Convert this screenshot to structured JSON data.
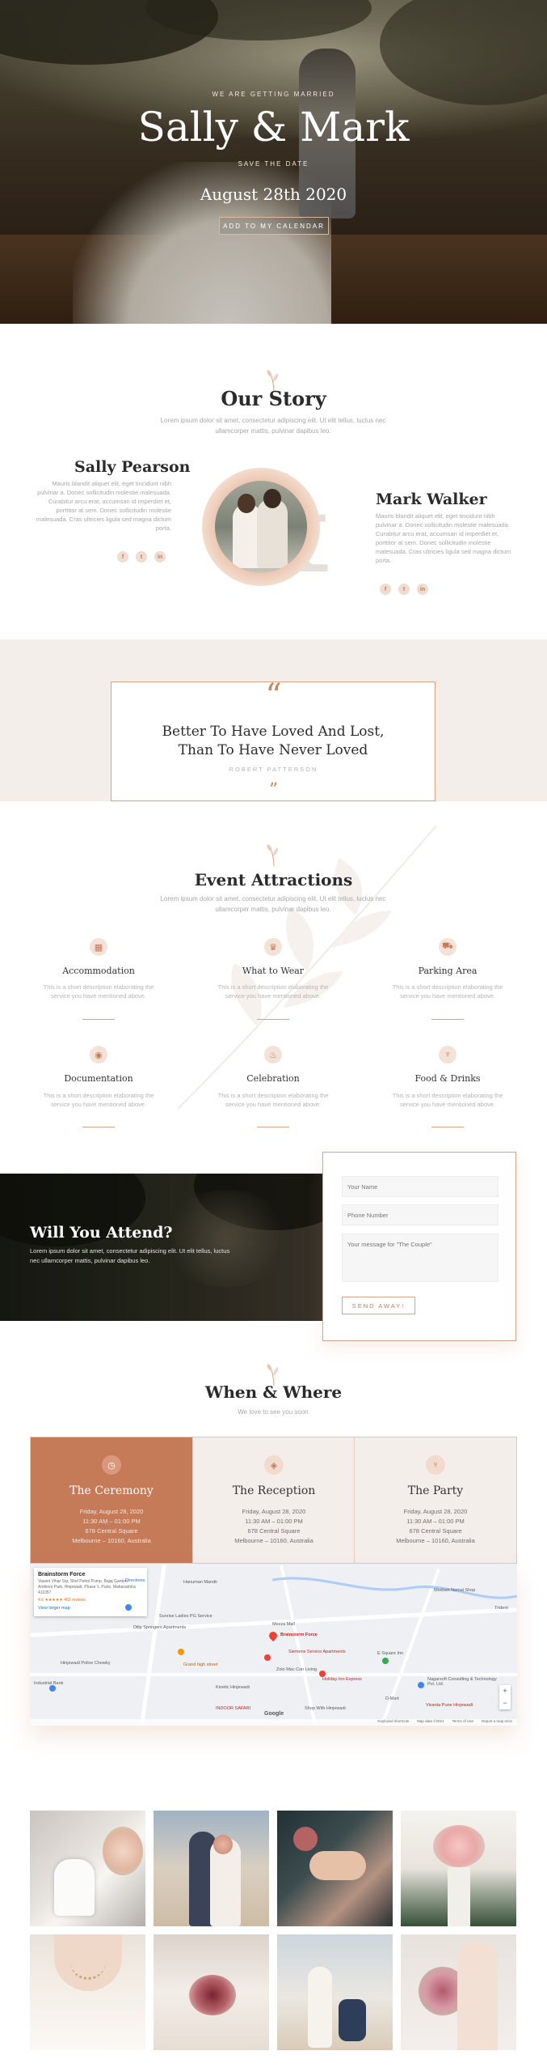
{
  "hero": {
    "eyebrow": "WE ARE GETTING MARRIED",
    "title": "Sally & Mark",
    "subtitle": "SAVE THE DATE",
    "date": "August 28th 2020",
    "button": "ADD TO MY CALENDAR"
  },
  "story": {
    "title": "Our Story",
    "text": "Lorem ipsum dolor sit amet, consectetur adipiscing elit. Ut elit tellus, luctus nec ullamcorper mattis, pulvinar dapibus leo.",
    "bride": {
      "name": "Sally Pearson",
      "text": "Mauris blandit aliquet elit, eget tincidunt nibh pulvinar a. Donec sollicitudin molestie malesuada. Curabitur arcu erat, accumsan id imperdiet et, porttitor at sem. Donec sollicitudin molestie malesuada. Cras ultricies ligula sed magna dictum porta.",
      "social": [
        "f",
        "t",
        "in"
      ]
    },
    "groom": {
      "name": "Mark Walker",
      "text": "Mauris blandit aliquet elit, eget tincidunt nibh pulvinar a. Donec sollicitudin molestie malesuada. Curabitur arcu erat, accumsan id imperdiet et, porttitor at sem. Donec sollicitudin molestie malesuada. Cras ultricies ligula sed magna dictum porta.",
      "social": [
        "f",
        "t",
        "in"
      ]
    },
    "ampersand": "&"
  },
  "quote": {
    "open_mark": "“",
    "line1": "Better To Have Loved And Lost,",
    "line2": "Than To Have Never Loved",
    "author": "ROBERT PATTERSON",
    "close_mark": "”"
  },
  "attractions": {
    "title": "Event Attractions",
    "text": "Lorem ipsum dolor sit amet, consectetur adipiscing elit. Ut elit tellus, luctus nec ullamcorper mattis, pulvinar dapibus leo.",
    "items": [
      {
        "icon": "hotel-icon",
        "glyph": "▦",
        "title": "Accommodation",
        "desc1": "This is a short description elaborating the",
        "desc2": "service you have mentioned above."
      },
      {
        "icon": "crown-icon",
        "glyph": "♛",
        "title": "What to Wear",
        "desc1": "This is a short description elaborating the",
        "desc2": "service you have mentioned above."
      },
      {
        "icon": "car-icon",
        "glyph": "⛟",
        "title": "Parking Area",
        "desc1": "This is a short description elaborating the",
        "desc2": "service you have mentioned above."
      },
      {
        "icon": "camera-icon",
        "glyph": "◉",
        "title": "Documentation",
        "desc1": "This is a short description elaborating the",
        "desc2": "service you have mentioned above."
      },
      {
        "icon": "cake-icon",
        "glyph": "♨",
        "title": "Celebration",
        "desc1": "This is a short description elaborating the",
        "desc2": "service you have mentioned above."
      },
      {
        "icon": "cocktail-icon",
        "glyph": "♆",
        "title": "Food & Drinks",
        "desc1": "This is a short description elaborating the",
        "desc2": "service you have mentioned above."
      }
    ]
  },
  "rsvp": {
    "title": "Will You Attend?",
    "text": "Lorem ipsum dolor sit amet, consectetur adipiscing elit. Ut elit tellus, luctus nec ullamcorper mattis, pulvinar dapibus leo.",
    "name_placeholder": "Your Name",
    "phone_placeholder": "Phone Number",
    "message_placeholder": "Your message for \"The Couple\"",
    "button": "SEND AWAY!"
  },
  "when": {
    "title": "When & Where",
    "subtitle": "We love to see you soon",
    "events": [
      {
        "icon": "clock-icon",
        "glyph": "◷",
        "title": "The Ceremony",
        "date": "Friday, August 28, 2020",
        "time": "11:30 AM – 01:00 PM",
        "street": "678 Central Square",
        "city": "Melbourne – 10160, Australia"
      },
      {
        "icon": "ring-icon",
        "glyph": "◈",
        "title": "The Reception",
        "date": "Friday, August 28, 2020",
        "time": "11:30 AM – 01:00 PM",
        "street": "678 Central Square",
        "city": "Melbourne – 10160, Australia"
      },
      {
        "icon": "cocktail-icon",
        "glyph": "♆",
        "title": "The Party",
        "date": "Friday, August 28, 2020",
        "time": "11:30 AM – 01:00 PM",
        "street": "678 Central Square",
        "city": "Melbourne – 10160, Australia"
      }
    ]
  },
  "map": {
    "card_title": "Brainstorm Force",
    "card_address": "Vasant Vihar Sqr, Shel Petrol Pump, Bajaj Garden Ambient Park, Hinjewadi, Phase 1, Pune, Maharashtra 411057",
    "card_rating": "4.6 ★★★★★  402 reviews",
    "card_link": "View larger map",
    "directions": "Directions",
    "pin_label": "Brainstorm Force",
    "labels": [
      "Hanuman Mandir",
      "Sunrise Ladies PG Service",
      "Dilip Springers Apartments",
      "Hinjewadi Police Chowky",
      "Grand high street",
      "Mezza Mall",
      "Zolo Mac Con Living",
      "Holiday Inn Express",
      "Siemens Service Apartments",
      "E Square Inn",
      "Nagarsoft Consulting & Technology Pvt. Ltd.",
      "Medosh Nemai Shop",
      "Trident",
      "INDOOR SAFARI",
      "Kinetic Hinjewadi",
      "Shop With Hinjewadi",
      "Industrial Bank",
      "D-Mart",
      "Vivanta Pune Hinjewadi"
    ],
    "zoom_in": "+",
    "zoom_out": "−",
    "footer": [
      "Keyboard shortcuts",
      "Map data ©2021",
      "Terms of Use",
      "Report a map error"
    ],
    "brand": "Google"
  },
  "gallery": {
    "items": [
      "wedding-shoes-photo",
      "couple-beach-photo",
      "holding-hands-photo",
      "bouquet-photo",
      "bride-necklace-photo",
      "bridal-bouquet-photo",
      "proposal-beach-photo",
      "bride-flowers-photo"
    ]
  },
  "colors": {
    "accent": "#c57a58",
    "accent_light": "#f4eeeb",
    "text_dark": "#2b2b2b"
  }
}
